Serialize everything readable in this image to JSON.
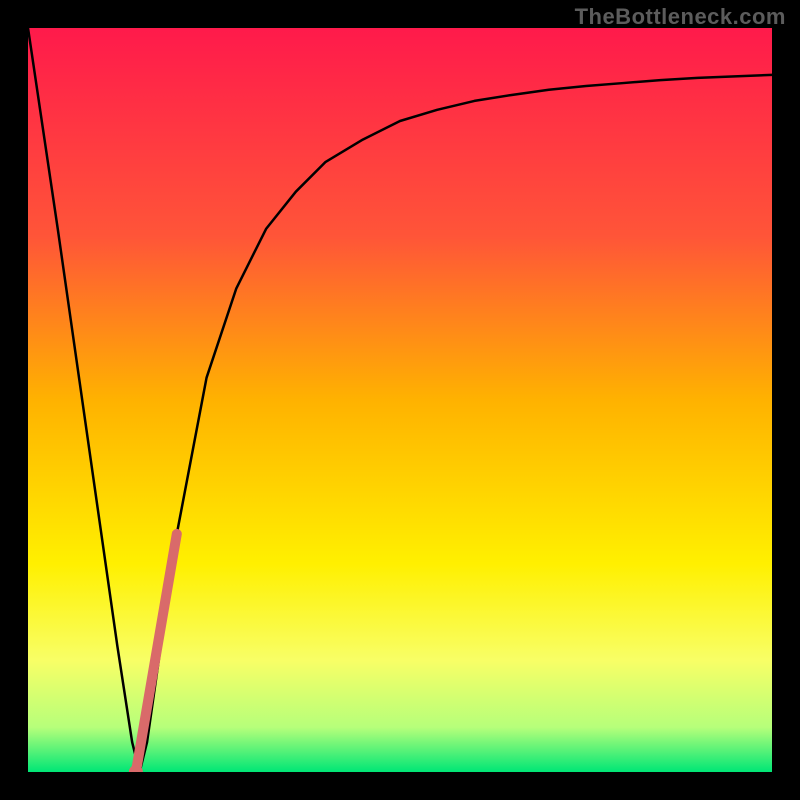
{
  "watermark": "TheBottleneck.com",
  "chart_data": {
    "type": "line",
    "title": "",
    "xlabel": "",
    "ylabel": "",
    "xlim": [
      0,
      100
    ],
    "ylim": [
      0,
      100
    ],
    "background_gradient": {
      "stops": [
        {
          "pos": 0,
          "color": "#ff1a4b"
        },
        {
          "pos": 28,
          "color": "#ff5538"
        },
        {
          "pos": 50,
          "color": "#ffb200"
        },
        {
          "pos": 72,
          "color": "#fff000"
        },
        {
          "pos": 85,
          "color": "#f8ff66"
        },
        {
          "pos": 94,
          "color": "#b6ff7a"
        },
        {
          "pos": 100,
          "color": "#00e676"
        }
      ]
    },
    "series": [
      {
        "name": "curve",
        "stroke": "#000000",
        "x": [
          0,
          4,
          8,
          10,
          12,
          14,
          15,
          16,
          18,
          20,
          24,
          28,
          32,
          36,
          40,
          45,
          50,
          55,
          60,
          65,
          70,
          75,
          80,
          85,
          90,
          95,
          100
        ],
        "y": [
          100,
          73,
          45,
          31,
          17,
          4,
          0,
          4,
          18,
          32,
          53,
          65,
          73,
          78,
          82,
          85,
          87.5,
          89,
          90.2,
          91,
          91.7,
          92.2,
          92.6,
          93,
          93.3,
          93.5,
          93.7
        ]
      },
      {
        "name": "highlight-segment",
        "stroke": "#d96a6a",
        "stroke_width": 10,
        "x": [
          14.5,
          20
        ],
        "y": [
          0,
          32
        ]
      },
      {
        "name": "highlight-dot",
        "stroke": "#d96a6a",
        "type_hint": "marker",
        "x": [
          14.5
        ],
        "y": [
          0
        ],
        "radius": 7
      }
    ]
  }
}
